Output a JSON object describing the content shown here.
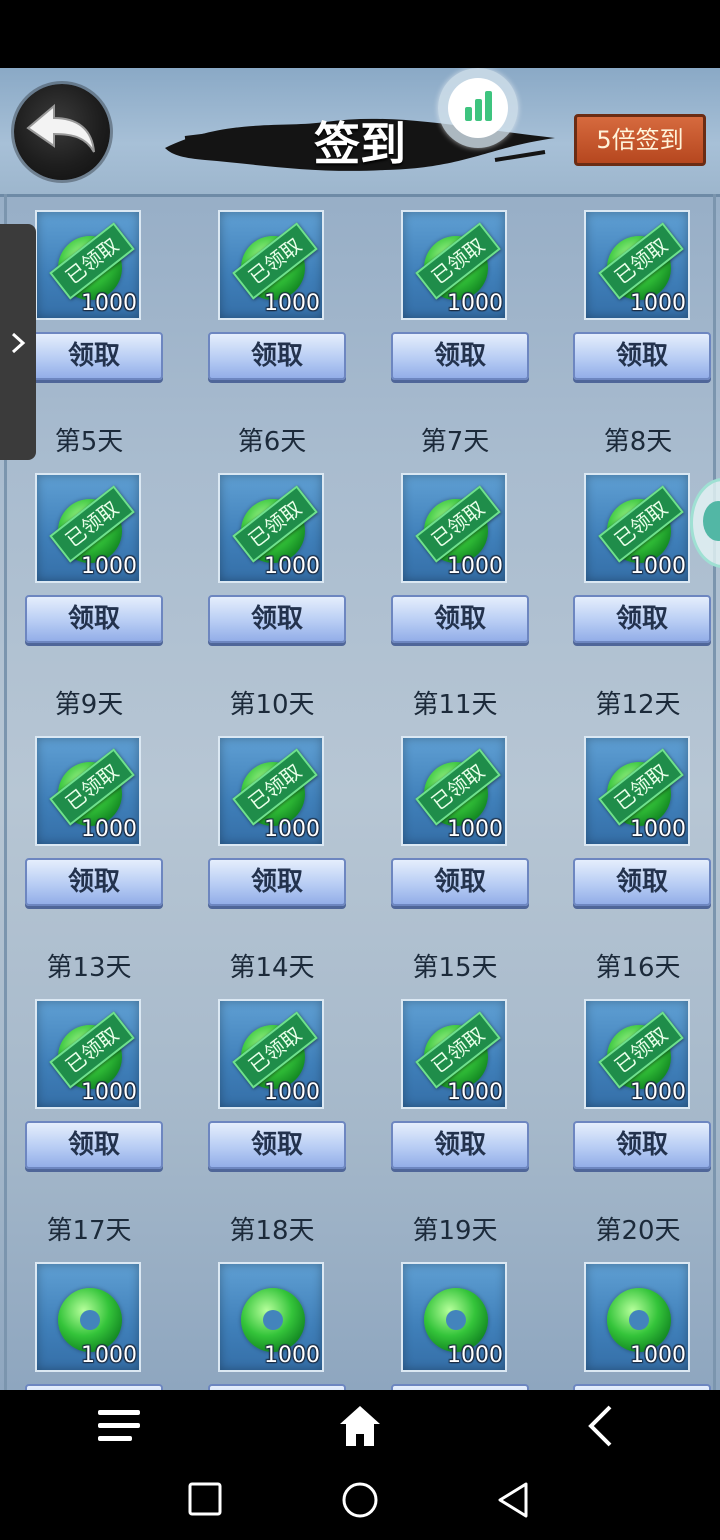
{
  "header": {
    "title": "签到",
    "multi_sign_label": "5倍签到"
  },
  "reward": {
    "amount": "1000",
    "claimed_stamp": "已领取",
    "claim_label": "领取"
  },
  "days": [
    {
      "label": "第5天"
    },
    {
      "label": "第6天"
    },
    {
      "label": "第7天"
    },
    {
      "label": "第8天"
    },
    {
      "label": "第9天"
    },
    {
      "label": "第10天"
    },
    {
      "label": "第11天"
    },
    {
      "label": "第12天"
    },
    {
      "label": "第13天"
    },
    {
      "label": "第14天"
    },
    {
      "label": "第15天"
    },
    {
      "label": "第16天"
    },
    {
      "label": "第17天"
    },
    {
      "label": "第18天"
    },
    {
      "label": "第19天"
    },
    {
      "label": "第20天"
    }
  ],
  "colors": {
    "claimed_stamp": "#1f8d4a",
    "multi_sign_button": "#c4582b",
    "stats_bars": "#3ec47f"
  },
  "icons": {
    "back": "curved-back-arrow-icon",
    "stats": "bar-chart-icon",
    "drawer": "chevron-right-icon",
    "nav_menu": "hamburger-menu-icon",
    "nav_home": "home-icon",
    "nav_back": "chevron-left-icon",
    "sys_recent": "square-icon",
    "sys_home": "circle-icon",
    "sys_back": "triangle-back-icon"
  }
}
